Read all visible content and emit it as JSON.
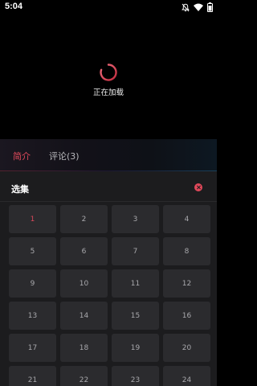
{
  "status_bar": {
    "time": "5:04",
    "icons": [
      "mute-bell-icon",
      "wifi-icon",
      "battery-icon"
    ]
  },
  "player": {
    "loading_text": "正在加载",
    "spinner_color": "#e24a5c"
  },
  "tabs": [
    {
      "label": "简介",
      "active": true
    },
    {
      "label": "评论(3)",
      "active": false
    }
  ],
  "episode_sheet": {
    "title": "选集",
    "selected_episode": "1",
    "episodes": [
      "1",
      "2",
      "3",
      "4",
      "5",
      "6",
      "7",
      "8",
      "9",
      "10",
      "11",
      "12",
      "13",
      "14",
      "15",
      "16",
      "17",
      "18",
      "19",
      "20",
      "21",
      "22",
      "23",
      "24"
    ]
  },
  "colors": {
    "accent": "#e24a5c",
    "background": "#000000",
    "sheet_bg": "#1c1c1e",
    "tile_bg": "#2b2b2e"
  }
}
